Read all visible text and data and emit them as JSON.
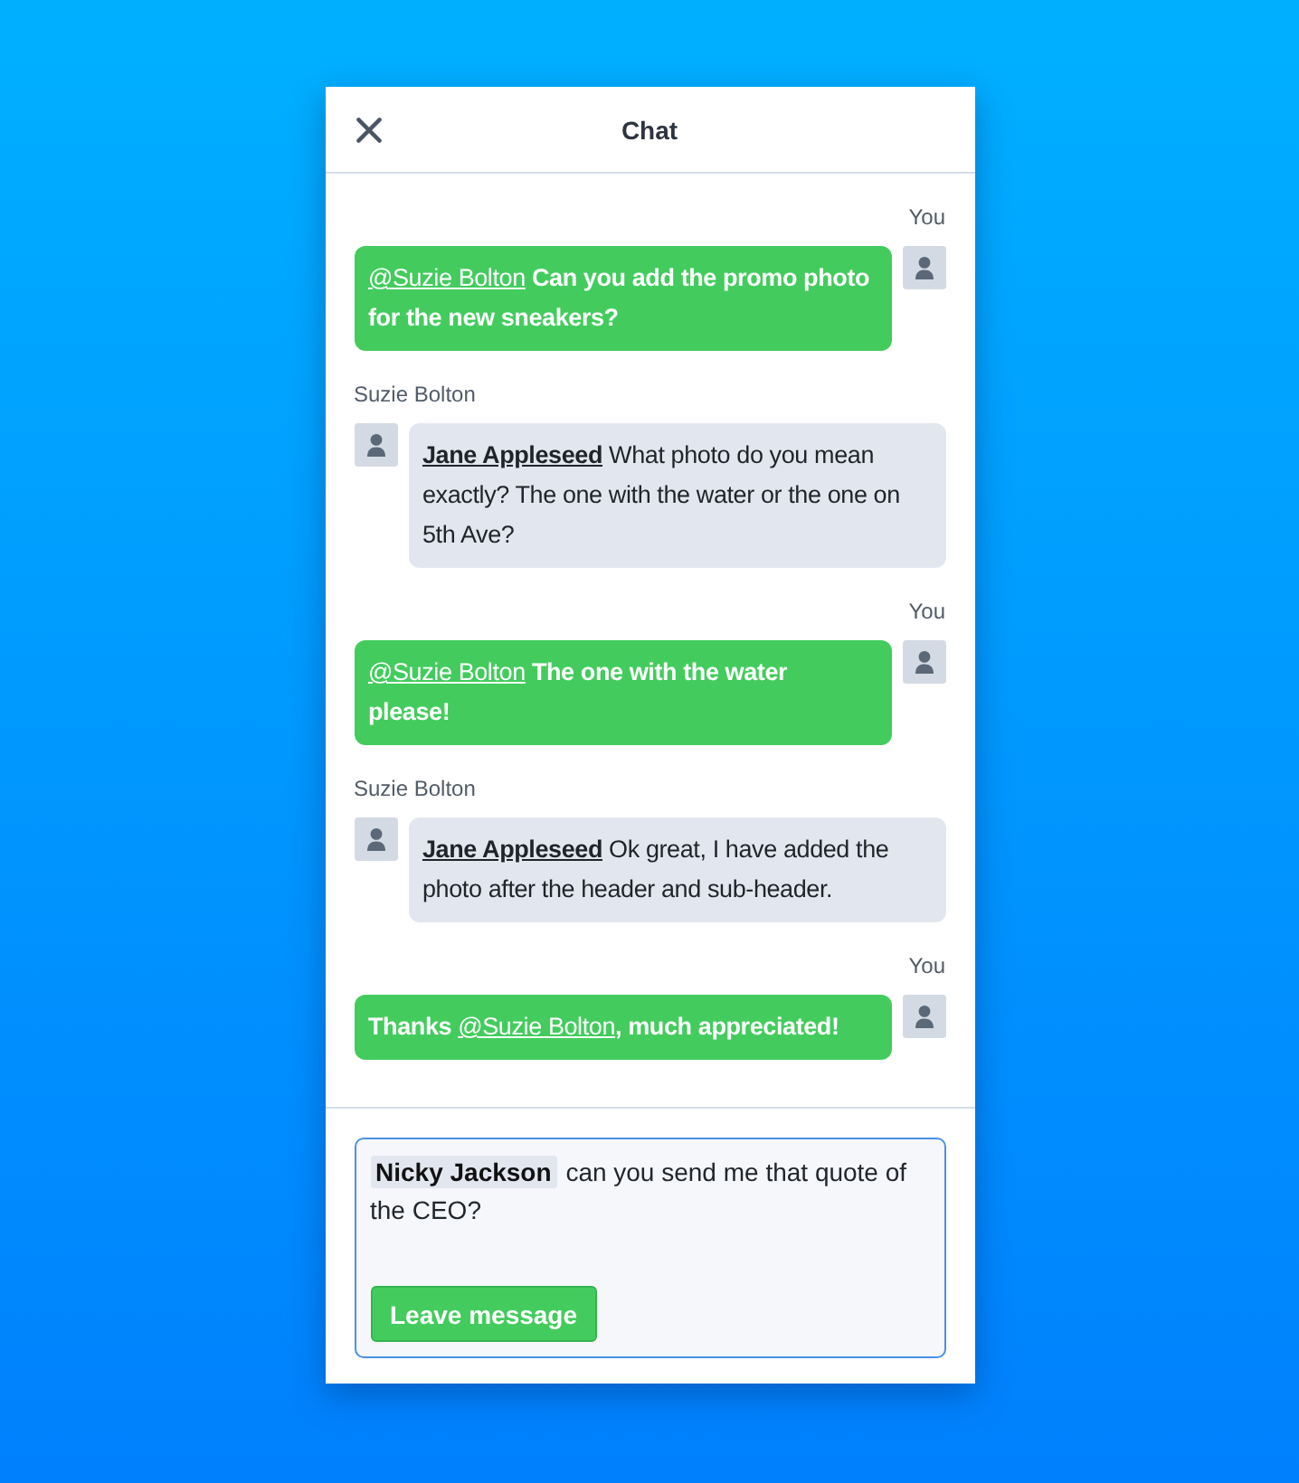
{
  "header": {
    "title": "Chat"
  },
  "messages": [
    {
      "kind": "sent",
      "sender": "You",
      "parts": [
        {
          "kind": "mention",
          "text": "@Suzie Bolton"
        },
        {
          "kind": "text",
          "text": " Can you add the promo photo for the new sneakers?"
        }
      ]
    },
    {
      "kind": "received",
      "sender": "Suzie Bolton",
      "parts": [
        {
          "kind": "mention",
          "text": "Jane Appleseed"
        },
        {
          "kind": "text",
          "text": " What photo do you mean exactly? The one with the water or the one on 5th Ave?"
        }
      ]
    },
    {
      "kind": "sent",
      "sender": "You",
      "parts": [
        {
          "kind": "mention",
          "text": "@Suzie Bolton"
        },
        {
          "kind": "text",
          "text": " The one with the water please!"
        }
      ]
    },
    {
      "kind": "received",
      "sender": "Suzie Bolton",
      "parts": [
        {
          "kind": "mention",
          "text": "Jane Appleseed"
        },
        {
          "kind": "text",
          "text": " Ok great, I have added the photo after the header and sub-header."
        }
      ]
    },
    {
      "kind": "sent",
      "sender": "You",
      "parts": [
        {
          "kind": "text",
          "text": "Thanks "
        },
        {
          "kind": "mention",
          "text": "@Suzie Bolton"
        },
        {
          "kind": "text",
          "text": ", much appreciated!"
        }
      ]
    }
  ],
  "composer": {
    "mention": "Nicky Jackson",
    "value": "can you send me that quote of the CEO?",
    "button": "Leave message"
  }
}
